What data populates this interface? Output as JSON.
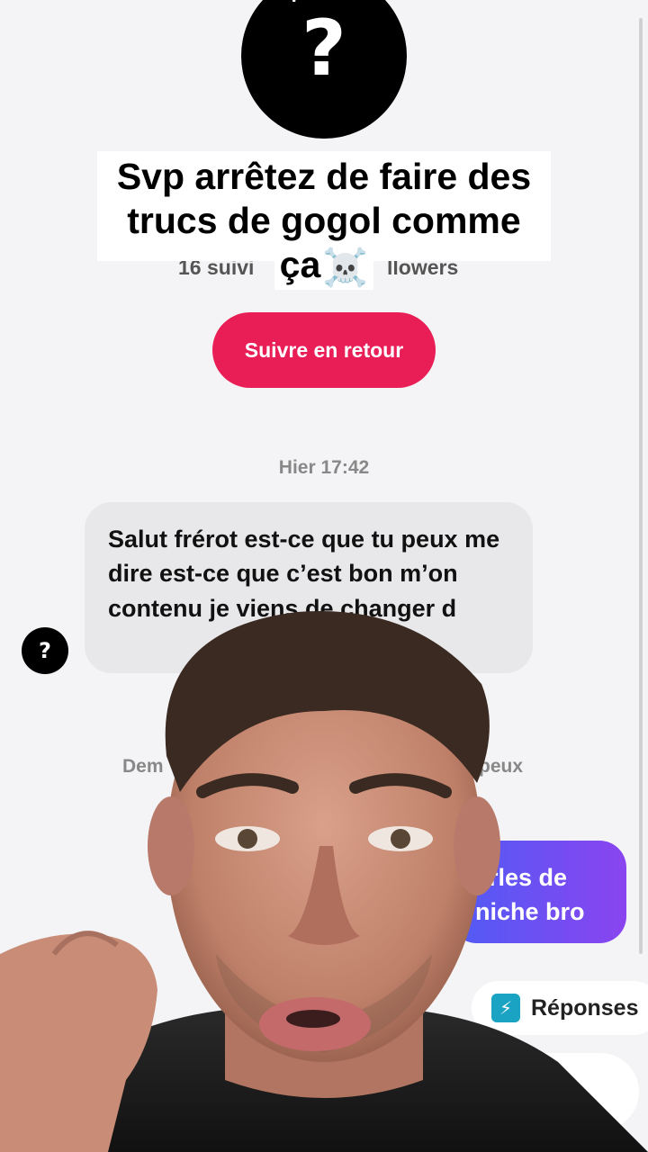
{
  "profile": {
    "avatar_glyph": "?",
    "followers_left": "16 suivi",
    "followers_right": "llowers",
    "follow_back_label": "Suivre en retour"
  },
  "caption": {
    "line1": "Svp arrêtez de faire des",
    "line2": "trucs de gogol comme",
    "line3": "ça",
    "emoji": "☠️"
  },
  "chat": {
    "timestamp_1": "Hier 17:42",
    "incoming_message": "Salut frérot est-ce que tu peux me dire est-ce que c’est bon m’on contenu je viens de changer d",
    "small_avatar_glyph": "?",
    "timestamp_2_left": "Dem",
    "timestamp_2_right": "peux",
    "outgoing_line1": "arles de",
    "outgoing_line2": "niche bro"
  },
  "replies_button": {
    "label": "Réponses",
    "icon": "lightning-icon"
  },
  "colors": {
    "follow_button": "#ea1e57",
    "outgoing_gradient_start": "#4f5cf5",
    "outgoing_gradient_end": "#8a44f0"
  }
}
